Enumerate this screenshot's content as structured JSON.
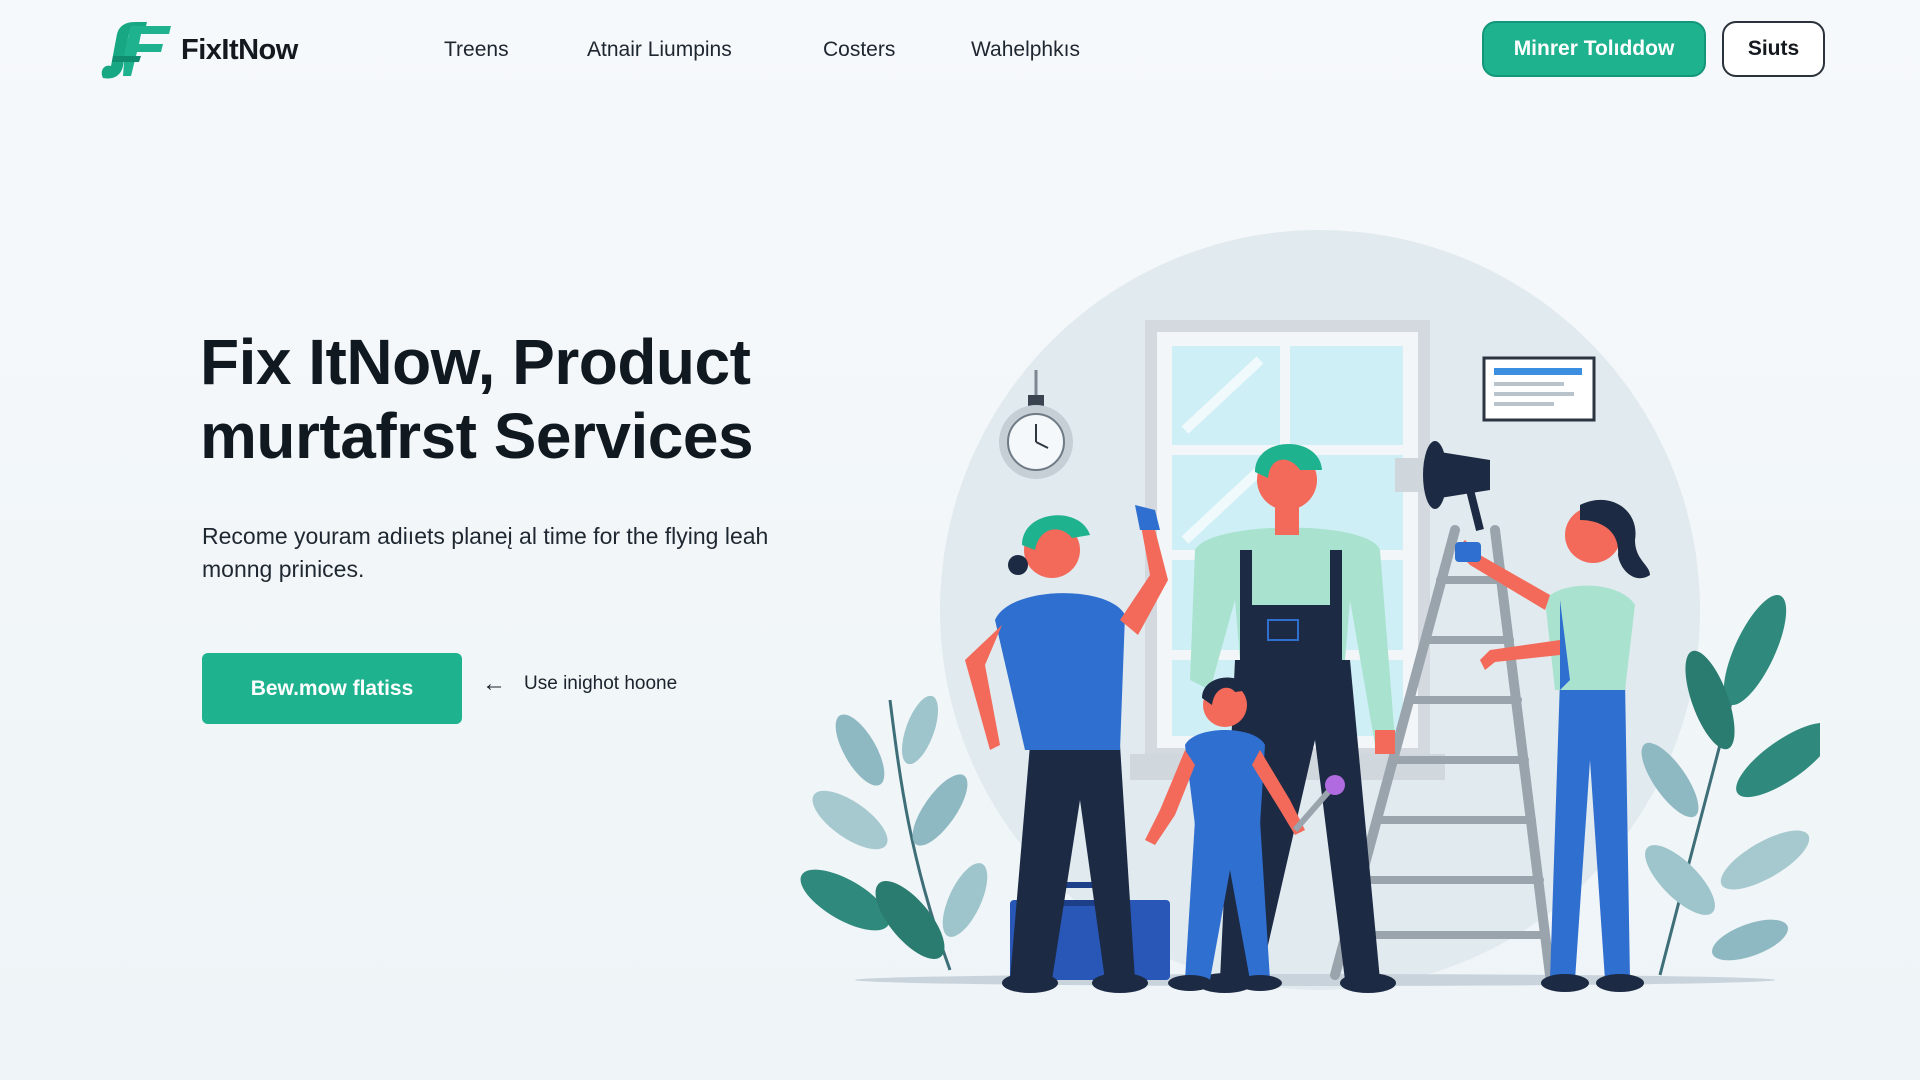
{
  "brand": {
    "name": "FixItNow",
    "logo_icon": "fixitnow-logo-icon"
  },
  "nav": {
    "links": [
      "Treens",
      "Atnair Liumpins",
      "Costers",
      "Wahelphkıs"
    ],
    "primary_button": "Minrer Tolıddow",
    "secondary_button": "Siuts"
  },
  "hero": {
    "title_line1": "Fix ItNow, Product",
    "title_line2": "murtafrst Services",
    "subtitle": "Recome youram adiıets planeį al time for the flying leah monng prinices.",
    "cta_label": "Bew.mow flatiss",
    "secondary_link": "Use inighot hoone",
    "secondary_link_icon": "arrow-left-icon"
  },
  "colors": {
    "accent": "#1fb28f",
    "accent_dark": "#13977a",
    "text": "#141a22",
    "worker_blue": "#2f6fd0",
    "worker_navy": "#1d2a44"
  }
}
